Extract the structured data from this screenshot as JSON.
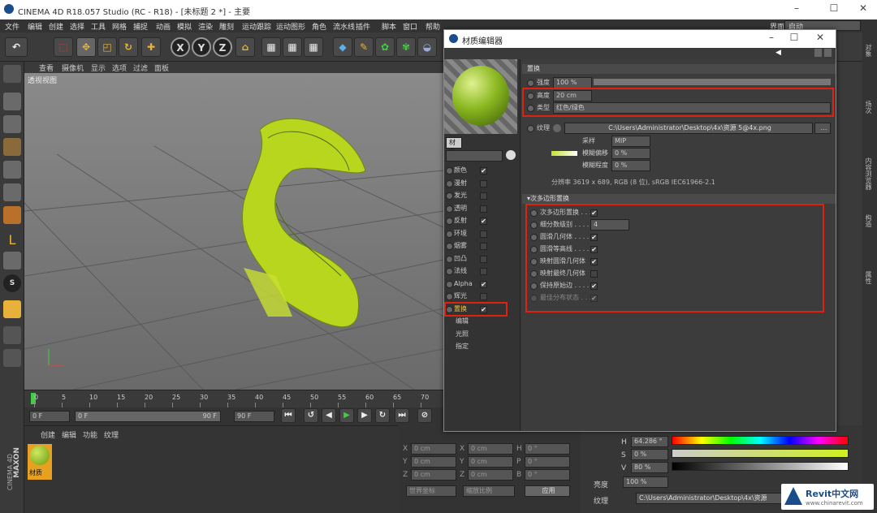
{
  "app": {
    "title": "CINEMA 4D R18.057 Studio (RC - R18) - [未标题 2 *] - 主要",
    "layout_label": "界面:",
    "layout_value": "启动"
  },
  "menu": [
    "文件",
    "编辑",
    "创建",
    "选择",
    "工具",
    "网格",
    "捕捉",
    "动画",
    "模拟",
    "渲染",
    "雕刻",
    "运动跟踪",
    "运动图形",
    "角色",
    "流水线",
    "插件",
    "脚本",
    "窗口",
    "帮助"
  ],
  "toolbar": {
    "x_label": "X",
    "y_label": "Y",
    "z_label": "Z"
  },
  "viewport": {
    "menu": [
      "查看",
      "摄像机",
      "显示",
      "选项",
      "过滤",
      "面板"
    ],
    "label": "透视视图"
  },
  "timeline": {
    "ticks": [
      "0",
      "5",
      "10",
      "15",
      "20",
      "25",
      "30",
      "35",
      "40",
      "45",
      "50",
      "55",
      "60",
      "65",
      "70"
    ],
    "start_field": "0 F",
    "range_start": "0 F",
    "range_end": "90 F",
    "end_field": "90 F"
  },
  "material_manager": {
    "menu": [
      "创建",
      "编辑",
      "功能",
      "纹理"
    ],
    "material_name": "材质"
  },
  "coords": {
    "rows": [
      {
        "a": "X",
        "av": "0 cm",
        "b": "X",
        "bv": "0 cm",
        "c": "H",
        "cv": "0 °"
      },
      {
        "a": "Y",
        "av": "0 cm",
        "b": "Y",
        "bv": "0 cm",
        "c": "P",
        "cv": "0 °"
      },
      {
        "a": "Z",
        "av": "0 cm",
        "b": "Z",
        "bv": "0 cm",
        "c": "B",
        "cv": "0 °"
      }
    ],
    "dropdown1": "世界坐标",
    "dropdown2": "缩放比例",
    "apply": "应用"
  },
  "attributes": {
    "h_label": "H",
    "h_value": "64.286 °",
    "s_label": "S",
    "s_value": "0 %",
    "v_label": "V",
    "v_value": "80 %",
    "brightness_label": "亮度",
    "brightness_value": "100 %",
    "texture_label": "纹理",
    "texture_path": "C:\\Users\\Administrator\\Desktop\\4x\\资源"
  },
  "brand": {
    "maxon": "MAXON",
    "c4d": "CINEMA 4D",
    "revit": "Revit中文网",
    "revit_url": "www.chinarevit.com"
  },
  "right_strip": [
    "对象",
    "场次",
    "内容浏览器",
    "构造",
    "属性"
  ],
  "dialog": {
    "title": "材质编辑器",
    "material_name": "材质",
    "channels": [
      {
        "name": "颜色",
        "checked": true
      },
      {
        "name": "漫射",
        "checked": false
      },
      {
        "name": "发光",
        "checked": false
      },
      {
        "name": "透明",
        "checked": false
      },
      {
        "name": "反射",
        "checked": true
      },
      {
        "name": "环境",
        "checked": false
      },
      {
        "name": "烟雾",
        "checked": false
      },
      {
        "name": "凹凸",
        "checked": false
      },
      {
        "name": "法线",
        "checked": false
      },
      {
        "name": "Alpha",
        "checked": true
      },
      {
        "name": "辉光",
        "checked": false
      },
      {
        "name": "置换",
        "checked": true
      }
    ],
    "sub_items": [
      "编辑",
      "光照",
      "指定"
    ],
    "section_title": "置换",
    "strength_label": "强度",
    "strength_value": "100 %",
    "height_label": "高度",
    "height_value": "20 cm",
    "type_label": "类型",
    "type_value": "红色/绿色",
    "texture_label": "纹理",
    "texture_path": "C:\\Users\\Administrator\\Desktop\\4x\\资源 5@4x.png",
    "sampling_label": "采样",
    "sampling_value": "MIP",
    "blur_offset_label": "模糊偏移",
    "blur_offset_value": "0 %",
    "blur_scale_label": "模糊程度",
    "blur_scale_value": "0 %",
    "resolution": "分辨率 3619 x 689, RGB (8 位), sRGB IEC61966-2.1",
    "subpoly_title": "▾次多边形置换",
    "subpoly": [
      {
        "label": "次多边形置换 . . .",
        "checked": true
      },
      {
        "label": "细分数级别 . . . . .",
        "value": "4"
      },
      {
        "label": "圆滑几何体 . . . .",
        "checked": true
      },
      {
        "label": "圆滑等高线 . . . .",
        "checked": true
      },
      {
        "label": "映射圆滑几何体",
        "checked": true
      },
      {
        "label": "映射最终几何体",
        "checked": false
      },
      {
        "label": "保持原始边 . . . .",
        "checked": true
      },
      {
        "label": "最佳分布状态 . . .",
        "checked": true
      }
    ]
  }
}
